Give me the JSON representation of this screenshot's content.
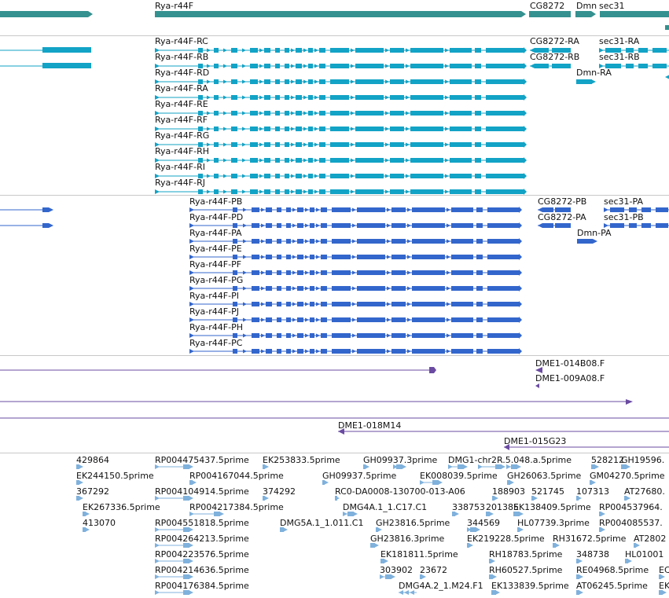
{
  "colors": {
    "gene": "#34918f",
    "transcript_rc": "#12a3c6",
    "transcript_pb": "#3366cc",
    "clone": "#6a4ba1",
    "est": "#7fb1dc",
    "divider": "#c8c8c8"
  },
  "gene_track": {
    "labels": [
      "Rya-r44F",
      "CG8272",
      "Dmn",
      "sec31"
    ]
  },
  "transcript_track_a": {
    "labels": [
      "Rya-r44F-RC",
      "Rya-r44F-RB",
      "Rya-r44F-RD",
      "Rya-r44F-RA",
      "Rya-r44F-RE",
      "Rya-r44F-RF",
      "Rya-r44F-RG",
      "Rya-r44F-RH",
      "Rya-r44F-RI",
      "Rya-r44F-RJ"
    ],
    "other_labels": [
      "CG8272-RA",
      "sec31-RA",
      "CG8272-RB",
      "sec31-RB",
      "Dmn-RA"
    ]
  },
  "transcript_track_b": {
    "labels": [
      "Rya-r44F-PB",
      "Rya-r44F-PD",
      "Rya-r44F-PA",
      "Rya-r44F-PE",
      "Rya-r44F-PF",
      "Rya-r44F-PG",
      "Rya-r44F-PI",
      "Rya-r44F-PJ",
      "Rya-r44F-PH",
      "Rya-r44F-PC"
    ],
    "other_labels": [
      "CG8272-PB",
      "sec31-PA",
      "CG8272-PA",
      "sec31-PB",
      "Dmn-PA"
    ]
  },
  "clone_track": {
    "labels": [
      "DME1-014B08.F",
      "DME1-009A08.F",
      "DME1-018M14",
      "DME1-015G23"
    ]
  },
  "est_track": {
    "labels": [
      "429864",
      "RP004475437.5prime",
      "EK253833.5prime",
      "GH09937.3prime",
      "DMG1-chr2R.5.048.a.5prime",
      "528212",
      "GH19596.",
      "EK244150.5prime",
      "RP004167044.5prime",
      "GH09937.5prime",
      "EK008039.5prime",
      "GH26063.5prime",
      "GM04270.5prime",
      "367292",
      "RP004104914.5prime",
      "374292",
      "RC0-DA0008-130700-013-A06",
      "188903",
      "521745",
      "107313",
      "AT27680.",
      "EK267336.5prime",
      "RP004217384.5prime",
      "DMG4A.1_1.C17.C1",
      "338753",
      "201385",
      "EK138409.5prime",
      "RP004537964.",
      "413070",
      "RP004551818.5prime",
      "DMG5A.1_1.011.C1",
      "GH23816.5prime",
      "344569",
      "HL07739.3prime",
      "RP004085537.",
      "RP004264213.5prime",
      "GH23816.3prime",
      "EK219228.5prime",
      "RH31672.5prime",
      "AT2802",
      "RP004223576.5prime",
      "EK181811.5prime",
      "RH18783.5prime",
      "348738",
      "HL01001",
      "RP004214636.5prime",
      "303902",
      "23672",
      "RH60527.5prime",
      "RE04968.5prime",
      "EC",
      "RP004176384.5prime",
      "DMG4A.2_1.M24.F1",
      "EK133839.5prime",
      "AT06245.5prime",
      "EK"
    ]
  }
}
